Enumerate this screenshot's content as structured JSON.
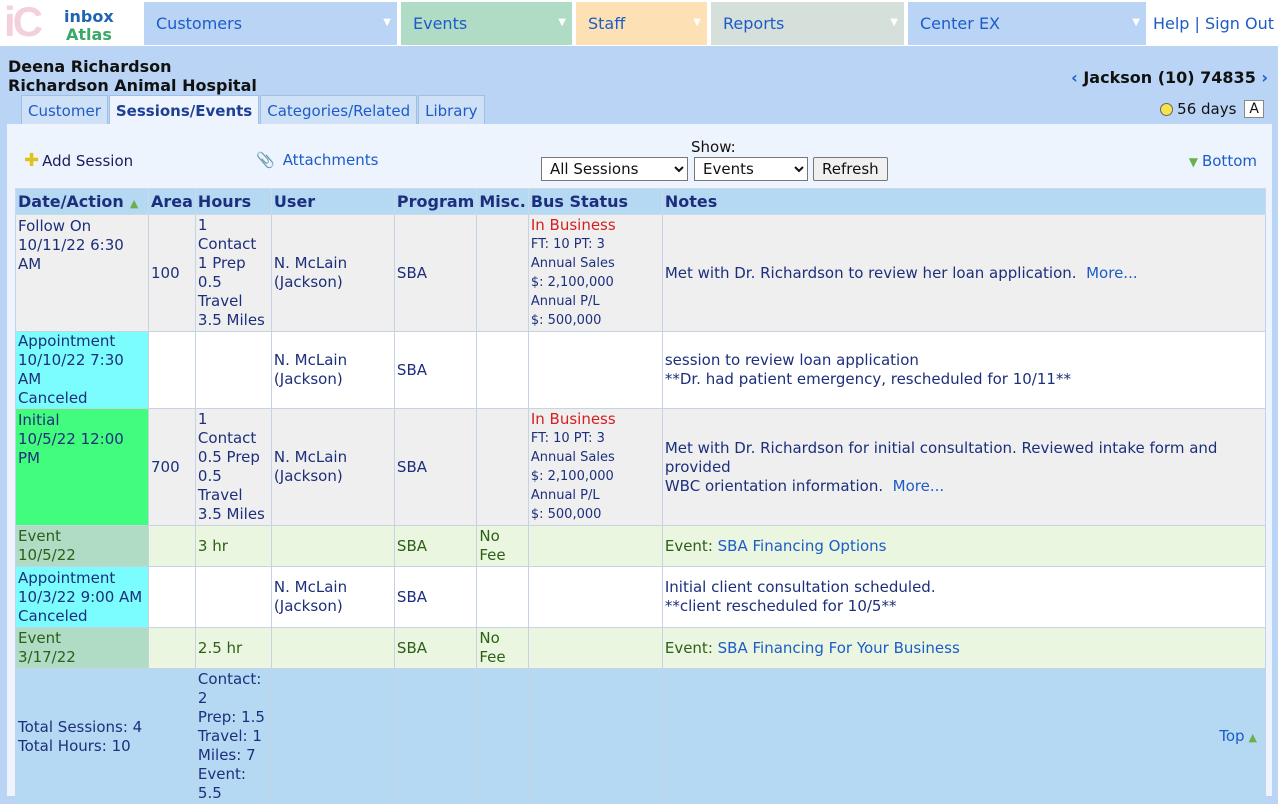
{
  "logo": {
    "mark": "iC",
    "line1": "inbox",
    "line2": "Atlas"
  },
  "menu": [
    {
      "label": "Customers",
      "color": "#b9d4f5"
    },
    {
      "label": "Events",
      "color": "#b0dbc4"
    },
    {
      "label": "Staff",
      "color": "#fde0b4"
    },
    {
      "label": "Reports",
      "color": "#d6e0da"
    },
    {
      "label": "Center EX",
      "color": "#b9d4f5"
    }
  ],
  "toplinks": {
    "help": "Help",
    "sep": "|",
    "signout": "Sign Out"
  },
  "client": {
    "name": "Deena Richardson",
    "company": "Richardson Animal Hospital"
  },
  "record_nav": {
    "prev": "‹",
    "label": "Jackson (10) 74835",
    "next": "›"
  },
  "tabs": [
    "Customer",
    "Sessions/Events",
    "Categories/Related",
    "Library"
  ],
  "age": {
    "text": "56 days",
    "badge": "A"
  },
  "actions": {
    "add_session": "Add Session",
    "attachments": "Attachments",
    "show_label": "Show:",
    "filter1": "All Sessions",
    "filter2": "Events",
    "refresh": "Refresh",
    "bottom": "Bottom"
  },
  "columns": [
    "Date/Action",
    "Area",
    "Hours",
    "User",
    "Program",
    "Misc.",
    "Bus Status",
    "Notes"
  ],
  "rows": [
    {
      "kind": "Follow On",
      "date": "10/11/22 6:30 AM",
      "status": "",
      "area": "100",
      "hours": [
        "1 Contact",
        "1 Prep",
        "0.5 Travel",
        "3.5 Miles"
      ],
      "user": [
        "N. McLain",
        "(Jackson)"
      ],
      "program": "SBA",
      "misc": "",
      "bus": {
        "state": "In Business",
        "lines": [
          "FT: 10 PT: 3",
          "Annual Sales",
          "$: 2,100,000",
          "Annual P/L",
          "$: 500,000"
        ]
      },
      "notes": [
        "Met with Dr. Richardson to review her loan application."
      ],
      "more": "More..."
    },
    {
      "kind": "Appointment",
      "date": "10/10/22 7:30 AM",
      "status": "Canceled",
      "area": "",
      "hours": [],
      "user": [
        "N. McLain",
        "(Jackson)"
      ],
      "program": "SBA",
      "misc": "",
      "bus": null,
      "notes": [
        "session to review loan application",
        "**Dr. had patient emergency, rescheduled for 10/11**"
      ],
      "more": ""
    },
    {
      "kind": "Initial",
      "date": "10/5/22 12:00 PM",
      "status": "",
      "area": "700",
      "hours": [
        "1 Contact",
        "0.5 Prep",
        "0.5 Travel",
        "3.5 Miles"
      ],
      "user": [
        "N. McLain",
        "(Jackson)"
      ],
      "program": "SBA",
      "misc": "",
      "bus": {
        "state": "In Business",
        "lines": [
          "FT: 10 PT: 3",
          "Annual Sales",
          "$: 2,100,000",
          "Annual P/L",
          "$: 500,000"
        ]
      },
      "notes": [
        "Met with Dr. Richardson for initial consultation. Reviewed intake form and provided",
        "WBC orientation information."
      ],
      "more": "More..."
    },
    {
      "kind": "Event",
      "date": "10/5/22",
      "status": "",
      "area": "",
      "hours": [
        "3 hr"
      ],
      "user": [],
      "program": "SBA",
      "misc": "No Fee",
      "bus": null,
      "notes": [],
      "event_prefix": "Event:",
      "event_name": "SBA Financing Options",
      "more": ""
    },
    {
      "kind": "Appointment",
      "date": "10/3/22 9:00 AM",
      "status": "Canceled",
      "area": "",
      "hours": [],
      "user": [
        "N. McLain",
        "(Jackson)"
      ],
      "program": "SBA",
      "misc": "",
      "bus": null,
      "notes": [
        "Initial client consultation scheduled.",
        "**client rescheduled for 10/5**"
      ],
      "more": ""
    },
    {
      "kind": "Event",
      "date": "3/17/22",
      "status": "",
      "area": "",
      "hours": [
        "2.5 hr"
      ],
      "user": [],
      "program": "SBA",
      "misc": "No Fee",
      "bus": null,
      "notes": [],
      "event_prefix": "Event:",
      "event_name": "SBA Financing For Your Business",
      "more": ""
    }
  ],
  "totals": {
    "sessions": "Total Sessions: 4",
    "hours": "Total Hours: 10",
    "breakdown": [
      "Contact:",
      "2",
      "Prep: 1.5",
      "Travel: 1",
      "Miles: 7",
      "Event:",
      "5.5"
    ],
    "top": "Top"
  }
}
